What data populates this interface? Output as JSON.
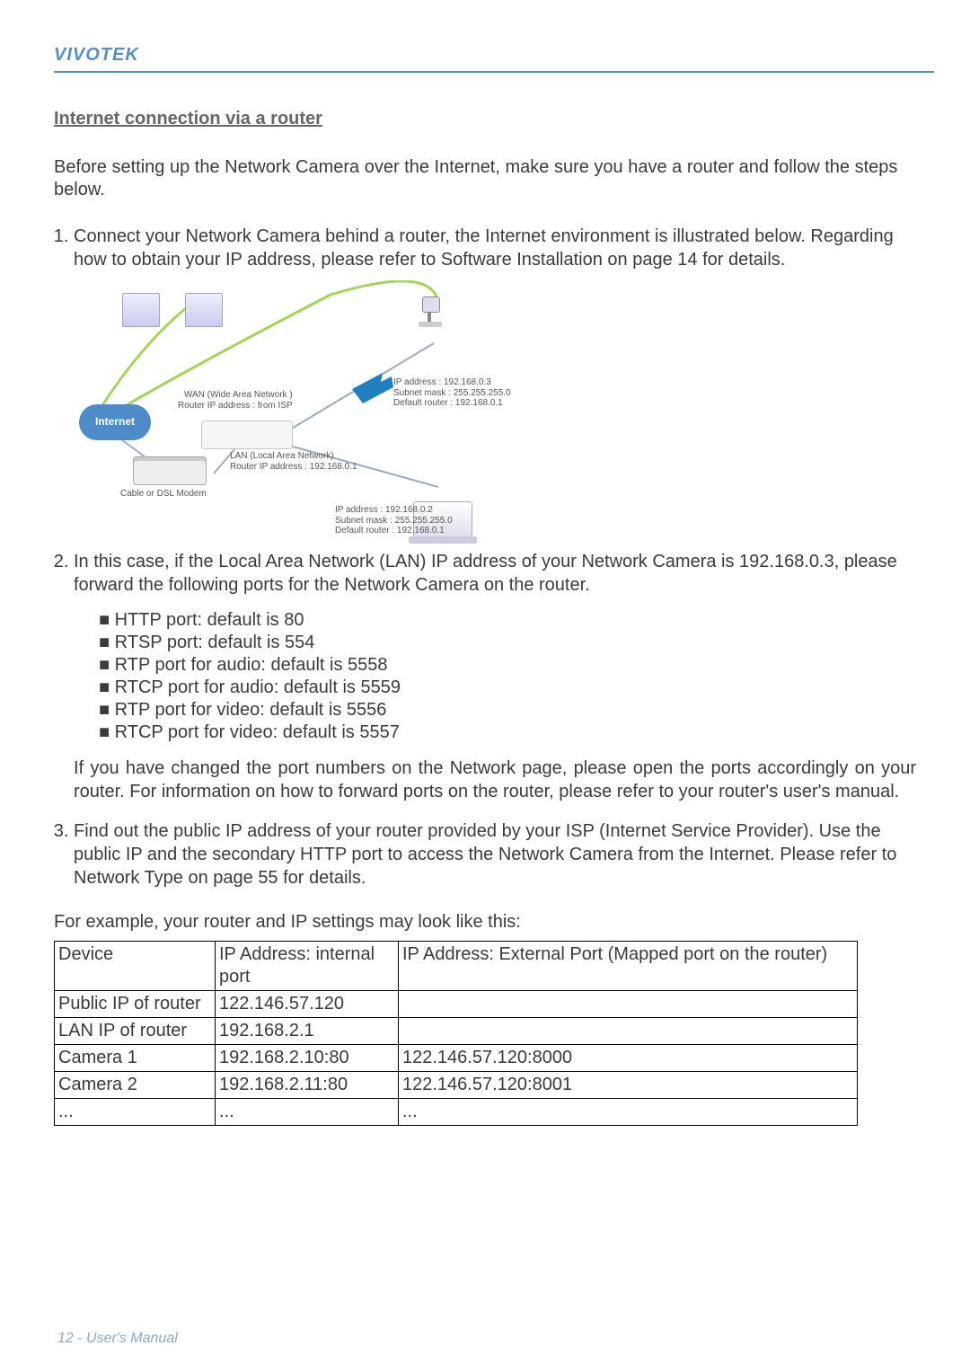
{
  "brand": "VIVOTEK",
  "section_title": "Internet connection via a router",
  "intro": "Before setting up the Network Camera over the Internet, make sure you have a router and follow the steps below.",
  "steps": {
    "s1": {
      "text": "Connect your Network Camera behind a router, the Internet environment is illustrated below. Regarding how to obtain your IP address, please refer to Software Installation on page 14 for details."
    },
    "s2": {
      "text": "In this case, if the Local Area Network (LAN) IP address of your Network Camera is 192.168.0.3, please forward the following ports for the Network Camera on the router.",
      "bullets": [
        "HTTP port: default is 80",
        "RTSP port: default is 554",
        "RTP port for audio: default is 5558",
        "RTCP port for audio: default is 5559",
        "RTP port for video: default is 5556",
        "RTCP port for video: default is 5557"
      ],
      "tail": "If you have changed the port numbers on the Network page, please open the ports accordingly on your router. For information on how to forward ports on the router, please refer to your router's user's manual."
    },
    "s3": {
      "text": "Find out the public IP address of your router provided by your ISP (Internet Service Provider). Use the public IP and the secondary HTTP port to access the Network Camera from the Internet. Please refer to Network Type on page 55 for details."
    }
  },
  "diagram": {
    "internet": "Internet",
    "wan": "WAN (Wide Area Network )\nRouter IP address : from ISP",
    "modem_label": "Cable or DSL Modem",
    "lan": "LAN (Local Area Network)\nRouter IP address : 192.168.0.1",
    "camera": "IP address : 192.168.0.3\nSubnet mask : 255.255.255.0\nDefault router : 192.168.0.1",
    "laptop": "IP address : 192.168.0.2\nSubnet mask : 255.255.255.0\nDefault router : 192.168.0.1"
  },
  "example_intro": "For example, your router and IP settings may look like this:",
  "table": {
    "headers": {
      "device": "Device",
      "internal": "IP Address: internal port",
      "external": "IP Address: External Port (Mapped port on the router)"
    },
    "rows": [
      {
        "device": "Public IP of router",
        "internal": "122.146.57.120",
        "external": ""
      },
      {
        "device": "LAN IP of router",
        "internal": "192.168.2.1",
        "external": ""
      },
      {
        "device": "Camera 1",
        "internal": "192.168.2.10:80",
        "external": "122.146.57.120:8000"
      },
      {
        "device": "Camera 2",
        "internal": "192.168.2.11:80",
        "external": "122.146.57.120:8001"
      },
      {
        "device": "...",
        "internal": "...",
        "external": "..."
      }
    ]
  },
  "footer": "12 - User's Manual"
}
